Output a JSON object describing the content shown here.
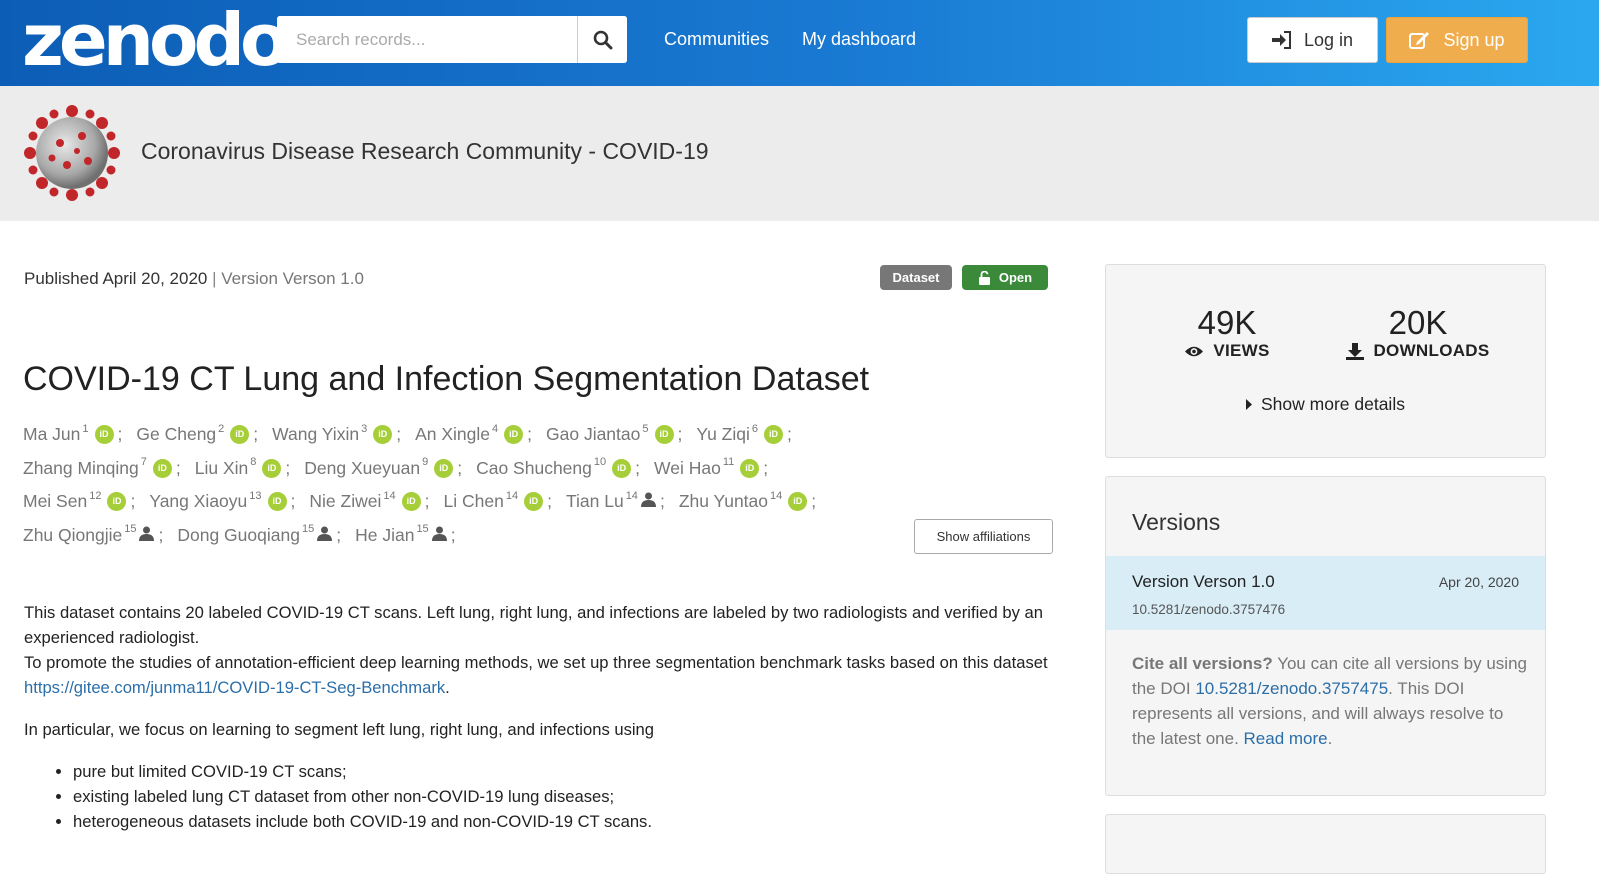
{
  "header": {
    "logo": "zenodo",
    "search_placeholder": "Search records...",
    "nav": [
      "Communities",
      "My dashboard"
    ],
    "login_label": "Log in",
    "signup_label": "Sign up"
  },
  "community": {
    "title": "Coronavirus Disease Research Community - COVID-19"
  },
  "record": {
    "published_prefix": "Published ",
    "published_date": "April 20, 2020",
    "separator": " | ",
    "version_label": "Version Verson 1.0",
    "badge_type": "Dataset",
    "badge_access": "Open",
    "title": "COVID-19 CT Lung and Infection Segmentation Dataset",
    "show_affiliations": "Show affiliations",
    "author_rows": [
      [
        {
          "name": "Ma Jun",
          "sup": "1",
          "orcid": true
        },
        {
          "name": "Ge Cheng",
          "sup": "2",
          "orcid": true
        },
        {
          "name": "Wang Yixin",
          "sup": "3",
          "orcid": true
        },
        {
          "name": "An Xingle",
          "sup": "4",
          "orcid": true
        },
        {
          "name": "Gao Jiantao",
          "sup": "5",
          "orcid": true
        },
        {
          "name": "Yu Ziqi",
          "sup": "6",
          "orcid": true
        }
      ],
      [
        {
          "name": "Zhang Minqing",
          "sup": "7",
          "orcid": true
        },
        {
          "name": "Liu Xin",
          "sup": "8",
          "orcid": true
        },
        {
          "name": "Deng Xueyuan",
          "sup": "9",
          "orcid": true
        },
        {
          "name": "Cao Shucheng",
          "sup": "10",
          "orcid": true
        },
        {
          "name": "Wei Hao",
          "sup": "11",
          "orcid": true
        }
      ],
      [
        {
          "name": "Mei Sen",
          "sup": "12",
          "orcid": true
        },
        {
          "name": "Yang Xiaoyu",
          "sup": "13",
          "orcid": true
        },
        {
          "name": "Nie Ziwei",
          "sup": "14",
          "orcid": true
        },
        {
          "name": "Li Chen",
          "sup": "14",
          "orcid": true
        },
        {
          "name": "Tian Lu",
          "sup": "14",
          "orcid": false
        },
        {
          "name": "Zhu Yuntao",
          "sup": "14",
          "orcid": true
        }
      ],
      [
        {
          "name": "Zhu Qiongjie",
          "sup": "15",
          "orcid": false
        },
        {
          "name": "Dong Guoqiang",
          "sup": "15",
          "orcid": false
        },
        {
          "name": "He Jian",
          "sup": "15",
          "orcid": false
        }
      ]
    ],
    "description": {
      "p1_line1": "This dataset contains 20 labeled COVID-19 CT scans. Left lung, right lung, and infections are labeled by two radiologists and verified by an experienced radiologist.",
      "p1_line2": "To promote the studies of annotation-efficient deep learning methods, we set up three segmentation benchmark tasks based on this dataset ",
      "p1_link": "https://gitee.com/junma11/COVID-19-CT-Seg-Benchmark",
      "p1_end": ".",
      "p2": "In particular, we focus on learning to segment left lung, right lung, and infections using",
      "bullets": [
        "pure but limited COVID-19 CT scans;",
        "existing labeled lung CT dataset from other non-COVID-19 lung diseases;",
        "heterogeneous datasets include both COVID-19 and non-COVID-19 CT scans."
      ]
    }
  },
  "stats": {
    "views_value": "49K",
    "views_label": "VIEWS",
    "downloads_value": "20K",
    "downloads_label": "DOWNLOADS",
    "show_more": "Show more details"
  },
  "versions": {
    "heading": "Versions",
    "current_name": "Version Verson 1.0",
    "current_date": "Apr 20, 2020",
    "current_doi": "10.5281/zenodo.3757476",
    "cite_bold": "Cite all versions?",
    "cite_text1": " You can cite all versions by using the DOI ",
    "cite_doi": "10.5281/zenodo.3757475",
    "cite_text2": ". This DOI represents all versions, and will always resolve to the latest one. ",
    "read_more": "Read more",
    "cite_end": "."
  },
  "colors": {
    "header_start": "#0c5db5",
    "header_end": "#2aa8ef",
    "signup": "#f0ad4e",
    "open_badge": "#3a8a3a",
    "orcid": "#a6ce39",
    "link": "#2b6ea8",
    "version_highlight": "#d9edf7"
  }
}
